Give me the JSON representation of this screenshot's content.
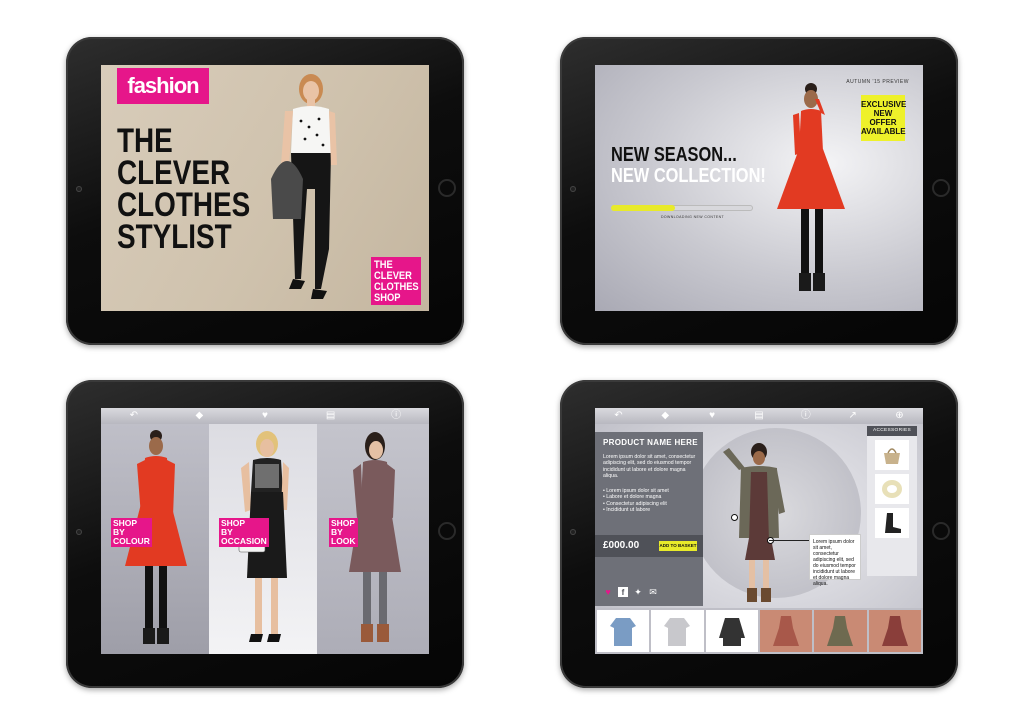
{
  "screen1": {
    "logo": "fashion",
    "headline": [
      "THE",
      "CLEVER",
      "CLOTHES",
      "STYLIST"
    ],
    "badge": [
      "THE",
      "CLEVER",
      "CLOTHES",
      "SHOP"
    ]
  },
  "screen2": {
    "preview_label": "AUTUMN '15 PREVIEW",
    "exclusive": [
      "EXCLUSIVE",
      "NEW",
      "OFFER",
      "AVAILABLE"
    ],
    "headline": [
      "NEW SEASON...",
      "NEW COLLECTION!"
    ],
    "progress_percent": 45,
    "progress_label": "DOWNLOADING NEW CONTENT"
  },
  "screen3": {
    "toolbar_icons": [
      "back-icon",
      "tag-icon",
      "heart-icon",
      "calculator-icon",
      "info-icon"
    ],
    "shop_labels": [
      [
        "SHOP",
        "BY",
        "COLOUR"
      ],
      [
        "SHOP",
        "BY",
        "OCCASION"
      ],
      [
        "SHOP",
        "BY",
        "LOOK"
      ]
    ]
  },
  "screen4": {
    "toolbar_icons": [
      "back-icon",
      "tag-icon",
      "heart-icon",
      "calculator-icon",
      "info-icon",
      "share-icon",
      "plus-icon"
    ],
    "product_name": "PRODUCT NAME HERE",
    "description": "Lorem ipsum dolor sit amet, consectetur adipiscing elit, sed do eiusmod tempor incididunt ut labore et dolore magna aliqua.",
    "bullets": [
      "Lorem ipsum dolor sit amet",
      "Labore et dolore magna",
      "Consectetur adipiscing elit",
      "Incididunt ut labore"
    ],
    "price": "£000.00",
    "add_to_basket": "ADD TO BASKET",
    "accessories_title": "ACCESSORIES",
    "note": "Lorem ipsum dolor sit amet, consectetur adipiscing elit, sed do eiusmod tempor incididunt ut labore et dolore magna aliqua."
  },
  "colors": {
    "brand_pink": "#e6168a",
    "accent_yellow": "#e8ea2a",
    "dress_red": "#e23a22"
  }
}
